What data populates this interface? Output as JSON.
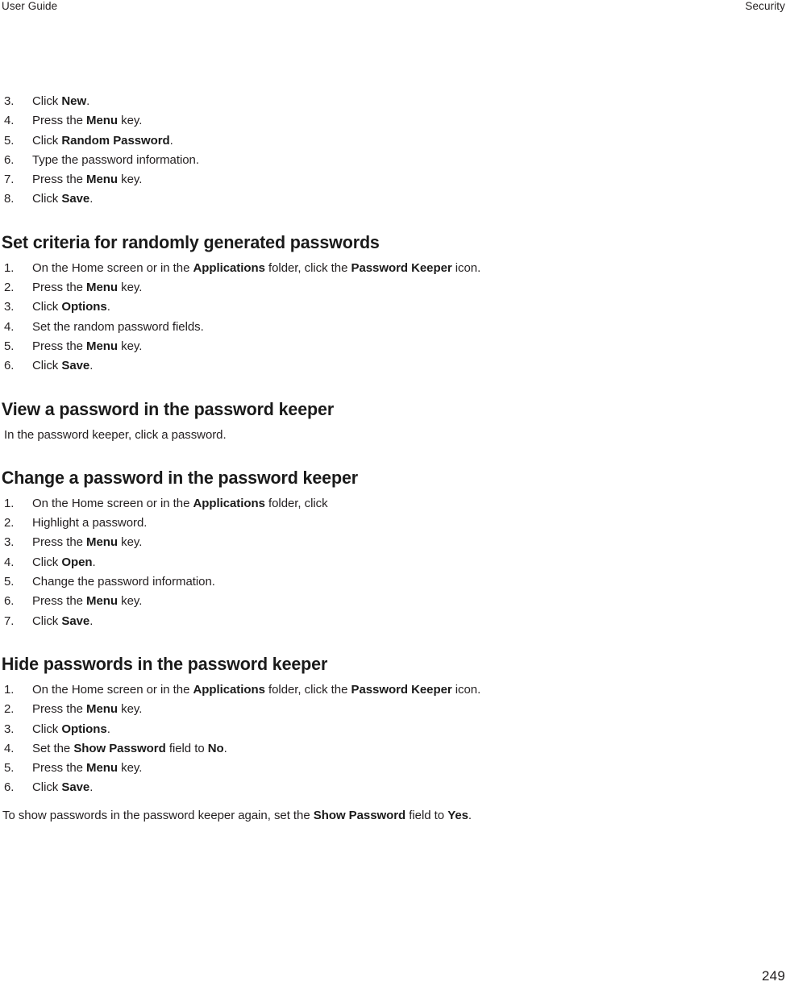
{
  "header": {
    "left": "User Guide",
    "right": "Security"
  },
  "footer": {
    "page_number": "249"
  },
  "sections": [
    {
      "id": "continued-list",
      "heading": null,
      "steps": [
        {
          "num": "3.",
          "parts": [
            {
              "t": "Click ",
              "b": false
            },
            {
              "t": "New",
              "b": true
            },
            {
              "t": ".",
              "b": false
            }
          ]
        },
        {
          "num": "4.",
          "parts": [
            {
              "t": "Press the ",
              "b": false
            },
            {
              "t": "Menu",
              "b": true
            },
            {
              "t": " key.",
              "b": false
            }
          ]
        },
        {
          "num": "5.",
          "parts": [
            {
              "t": "Click ",
              "b": false
            },
            {
              "t": "Random Password",
              "b": true
            },
            {
              "t": ".",
              "b": false
            }
          ]
        },
        {
          "num": "6.",
          "parts": [
            {
              "t": "Type the password information.",
              "b": false
            }
          ]
        },
        {
          "num": "7.",
          "parts": [
            {
              "t": "Press the ",
              "b": false
            },
            {
              "t": "Menu",
              "b": true
            },
            {
              "t": " key.",
              "b": false
            }
          ]
        },
        {
          "num": "8.",
          "parts": [
            {
              "t": "Click ",
              "b": false
            },
            {
              "t": "Save",
              "b": true
            },
            {
              "t": ".",
              "b": false
            }
          ]
        }
      ],
      "paragraphs": []
    },
    {
      "id": "set-criteria",
      "heading": "Set criteria for randomly generated passwords",
      "steps": [
        {
          "num": "1.",
          "parts": [
            {
              "t": "On the Home screen or in the ",
              "b": false
            },
            {
              "t": "Applications",
              "b": true
            },
            {
              "t": " folder, click the ",
              "b": false
            },
            {
              "t": "Password Keeper",
              "b": true
            },
            {
              "t": " icon.",
              "b": false
            }
          ]
        },
        {
          "num": "2.",
          "parts": [
            {
              "t": "Press the ",
              "b": false
            },
            {
              "t": "Menu",
              "b": true
            },
            {
              "t": " key.",
              "b": false
            }
          ]
        },
        {
          "num": "3.",
          "parts": [
            {
              "t": "Click ",
              "b": false
            },
            {
              "t": "Options",
              "b": true
            },
            {
              "t": ".",
              "b": false
            }
          ]
        },
        {
          "num": "4.",
          "parts": [
            {
              "t": "Set the random password fields.",
              "b": false
            }
          ]
        },
        {
          "num": "5.",
          "parts": [
            {
              "t": "Press the ",
              "b": false
            },
            {
              "t": "Menu",
              "b": true
            },
            {
              "t": " key.",
              "b": false
            }
          ]
        },
        {
          "num": "6.",
          "parts": [
            {
              "t": "Click ",
              "b": false
            },
            {
              "t": "Save",
              "b": true
            },
            {
              "t": ".",
              "b": false
            }
          ]
        }
      ],
      "paragraphs": []
    },
    {
      "id": "view-password",
      "heading": "View a password in the password keeper",
      "steps": [],
      "paragraphs": [
        {
          "indented": true,
          "parts": [
            {
              "t": "In the password keeper, click a password.",
              "b": false
            }
          ]
        }
      ]
    },
    {
      "id": "change-password",
      "heading": "Change a password in the password keeper",
      "steps": [
        {
          "num": "1.",
          "parts": [
            {
              "t": "On the Home screen or in the ",
              "b": false
            },
            {
              "t": "Applications",
              "b": true
            },
            {
              "t": " folder, click",
              "b": false
            }
          ]
        },
        {
          "num": "2.",
          "parts": [
            {
              "t": "Highlight a password.",
              "b": false
            }
          ]
        },
        {
          "num": "3.",
          "parts": [
            {
              "t": "Press the ",
              "b": false
            },
            {
              "t": "Menu",
              "b": true
            },
            {
              "t": " key.",
              "b": false
            }
          ]
        },
        {
          "num": "4.",
          "parts": [
            {
              "t": "Click ",
              "b": false
            },
            {
              "t": "Open",
              "b": true
            },
            {
              "t": ".",
              "b": false
            }
          ]
        },
        {
          "num": "5.",
          "parts": [
            {
              "t": "Change the password information.",
              "b": false
            }
          ]
        },
        {
          "num": "6.",
          "parts": [
            {
              "t": "Press the ",
              "b": false
            },
            {
              "t": "Menu",
              "b": true
            },
            {
              "t": " key.",
              "b": false
            }
          ]
        },
        {
          "num": "7.",
          "parts": [
            {
              "t": "Click ",
              "b": false
            },
            {
              "t": "Save",
              "b": true
            },
            {
              "t": ".",
              "b": false
            }
          ]
        }
      ],
      "paragraphs": []
    },
    {
      "id": "hide-passwords",
      "heading": "Hide passwords in the password keeper",
      "steps": [
        {
          "num": "1.",
          "parts": [
            {
              "t": "On the Home screen or in the ",
              "b": false
            },
            {
              "t": "Applications",
              "b": true
            },
            {
              "t": " folder, click the ",
              "b": false
            },
            {
              "t": "Password Keeper",
              "b": true
            },
            {
              "t": " icon.",
              "b": false
            }
          ]
        },
        {
          "num": "2.",
          "parts": [
            {
              "t": "Press the ",
              "b": false
            },
            {
              "t": "Menu",
              "b": true
            },
            {
              "t": " key.",
              "b": false
            }
          ]
        },
        {
          "num": "3.",
          "parts": [
            {
              "t": "Click ",
              "b": false
            },
            {
              "t": "Options",
              "b": true
            },
            {
              "t": ".",
              "b": false
            }
          ]
        },
        {
          "num": "4.",
          "parts": [
            {
              "t": "Set the ",
              "b": false
            },
            {
              "t": "Show Password",
              "b": true
            },
            {
              "t": " field to ",
              "b": false
            },
            {
              "t": "No",
              "b": true
            },
            {
              "t": ".",
              "b": false
            }
          ]
        },
        {
          "num": "5.",
          "parts": [
            {
              "t": "Press the ",
              "b": false
            },
            {
              "t": "Menu",
              "b": true
            },
            {
              "t": " key.",
              "b": false
            }
          ]
        },
        {
          "num": "6.",
          "parts": [
            {
              "t": "Click ",
              "b": false
            },
            {
              "t": "Save",
              "b": true
            },
            {
              "t": ".",
              "b": false
            }
          ]
        }
      ],
      "paragraphs": [
        {
          "indented": false,
          "parts": [
            {
              "t": "To show passwords in the password keeper again, set the ",
              "b": false
            },
            {
              "t": "Show Password",
              "b": true
            },
            {
              "t": " field to ",
              "b": false
            },
            {
              "t": "Yes",
              "b": true
            },
            {
              "t": ".",
              "b": false
            }
          ]
        }
      ]
    }
  ]
}
